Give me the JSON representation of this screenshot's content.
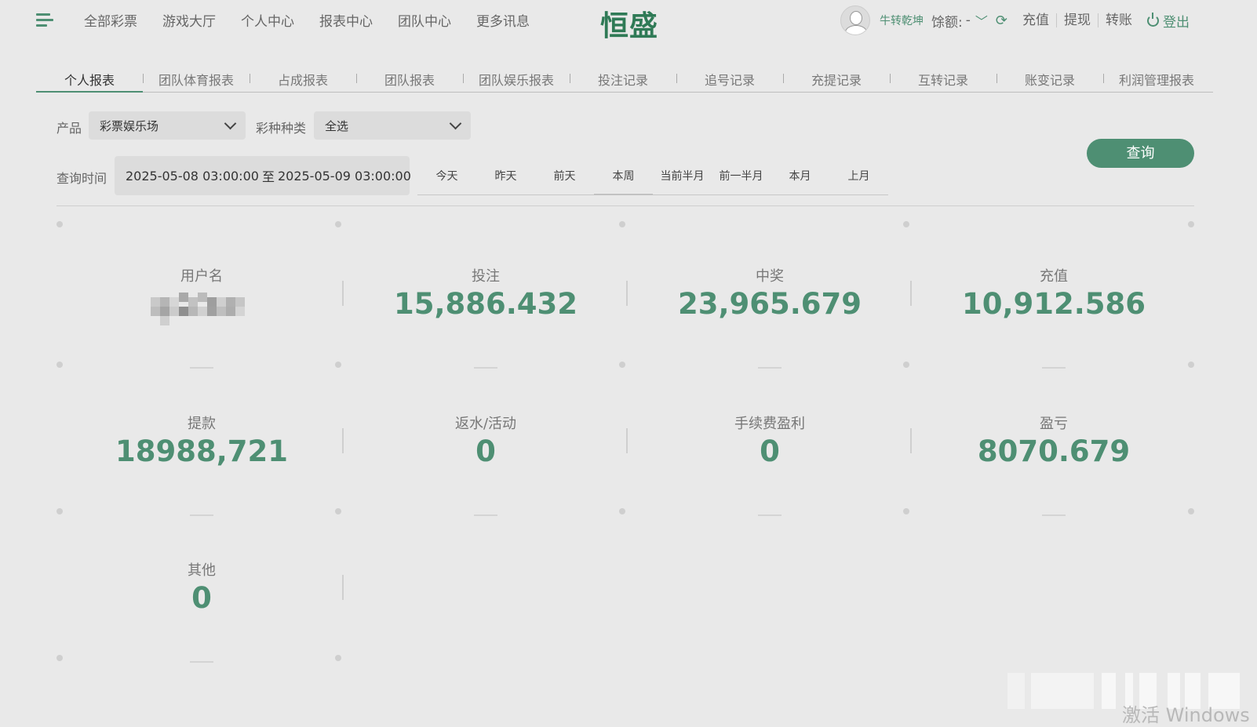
{
  "header": {
    "nav": [
      "全部彩票",
      "游戏大厅",
      "个人中心",
      "报表中心",
      "团队中心",
      "更多讯息"
    ],
    "logo": "恒盛",
    "username": "牛转乾坤",
    "balance_label": "馀额:",
    "balance_value": "-",
    "links": [
      "充值",
      "提现",
      "转账"
    ],
    "logout": "登出"
  },
  "tabs": [
    "个人报表",
    "团队体育报表",
    "占成报表",
    "团队报表",
    "团队娱乐报表",
    "投注记录",
    "追号记录",
    "充提记录",
    "互转记录",
    "账变记录",
    "利润管理报表"
  ],
  "filters": {
    "product_label": "产品",
    "product_value": "彩票娱乐场",
    "lottery_label": "彩种种类",
    "lottery_value": "全选",
    "time_label": "查询时间",
    "start": "2025-05-08 03:00:00",
    "sep": "至",
    "end": "2025-05-09 03:00:00",
    "quick": [
      "今天",
      "昨天",
      "前天",
      "本周",
      "当前半月",
      "前一半月",
      "本月",
      "上月"
    ],
    "quick_active": "本周",
    "search": "查询"
  },
  "stats": {
    "username_title": "用户名",
    "items": [
      {
        "title": "投注",
        "value": "15,886.432"
      },
      {
        "title": "中奖",
        "value": "23,965.679"
      },
      {
        "title": "充值",
        "value": "10,912.586"
      },
      {
        "title": "提款",
        "value": "18988,721"
      },
      {
        "title": "返水/活动",
        "value": "0"
      },
      {
        "title": "手续费盈利",
        "value": "0"
      },
      {
        "title": "盈亏",
        "value": "8070.679"
      },
      {
        "title": "其他",
        "value": "0"
      }
    ]
  },
  "watermark": "激活 Windows",
  "colors": {
    "accent": "#4e8f73",
    "background": "#e9e9e9"
  }
}
